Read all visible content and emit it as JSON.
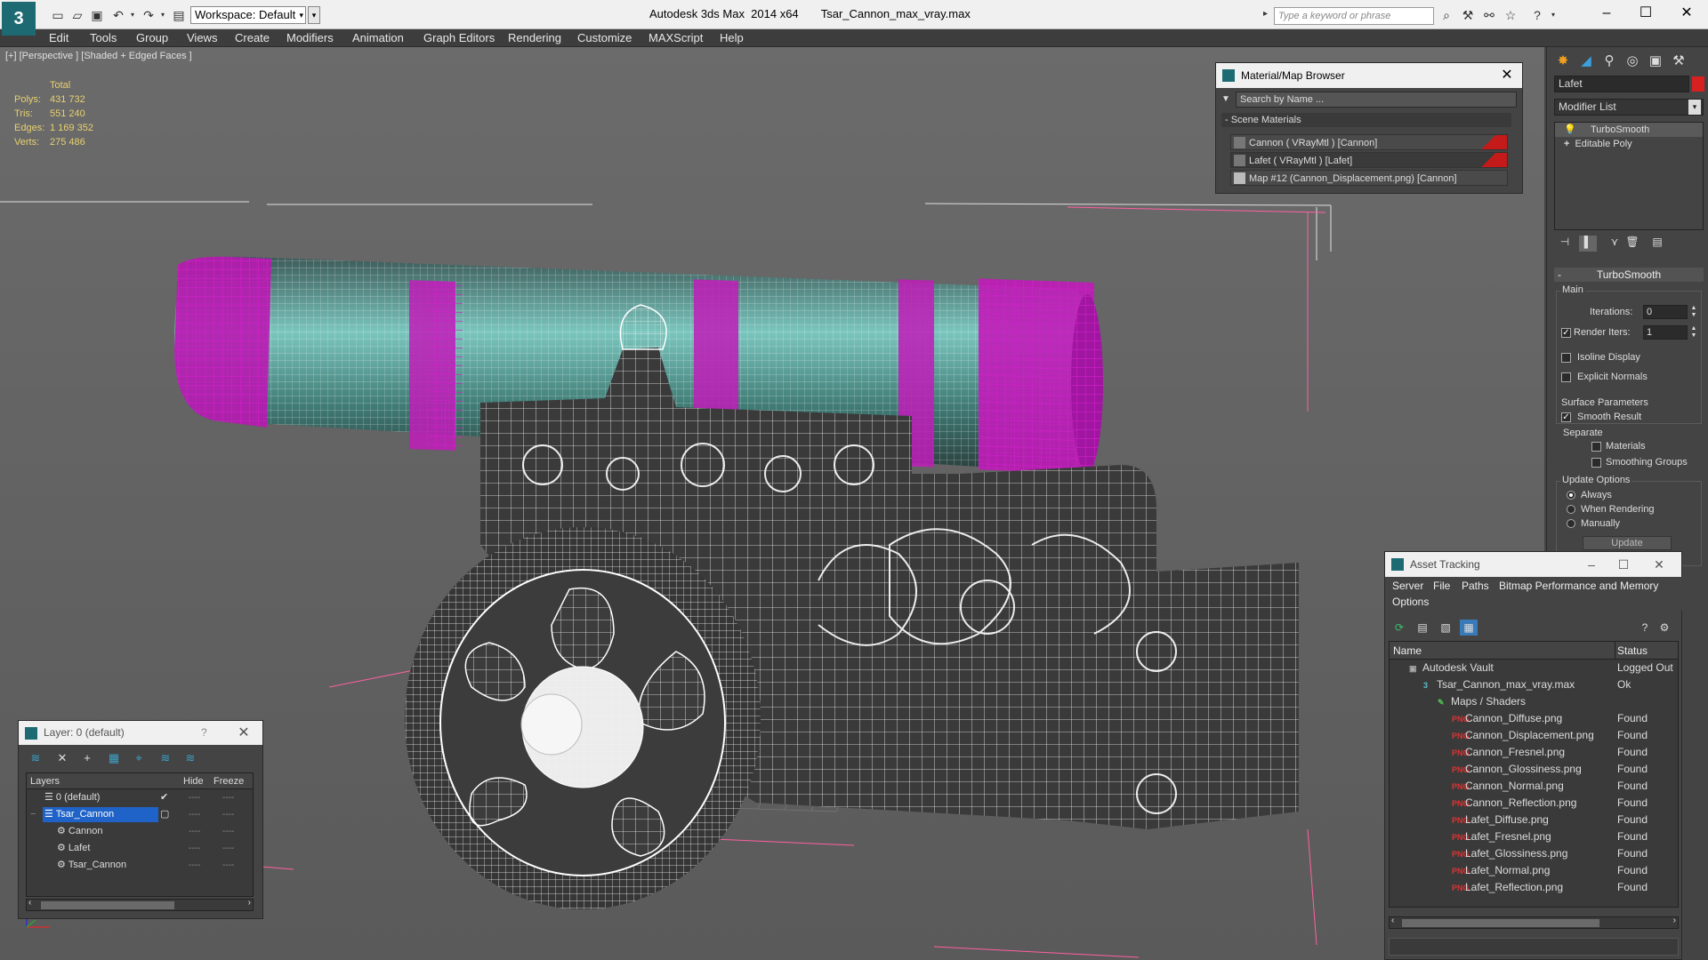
{
  "titlebar": {
    "workspace": "Workspace: Default",
    "app_title": "Autodesk 3ds Max  2014 x64",
    "file_title": "Tsar_Cannon_max_vray.max",
    "search_placeholder": "Type a keyword or phrase"
  },
  "menu": [
    "Edit",
    "Tools",
    "Group",
    "Views",
    "Create",
    "Modifiers",
    "Animation",
    "Graph Editors",
    "Rendering",
    "Customize",
    "MAXScript",
    "Help"
  ],
  "viewport": {
    "label": "[+] [Perspective ] [Shaded + Edged Faces ]",
    "stats": {
      "header": "Total",
      "polys_label": "Polys:",
      "polys": "431 732",
      "tris_label": "Tris:",
      "tris": "551 240",
      "edges_label": "Edges:",
      "edges": "1 169 352",
      "verts_label": "Verts:",
      "verts": "275 486"
    }
  },
  "material_browser": {
    "title": "Material/Map Browser",
    "search_placeholder": "Search by Name ...",
    "group": "- Scene Materials",
    "items": [
      "Cannon  ( VRayMtl ) [Cannon]",
      "Lafet  ( VRayMtl ) [Lafet]",
      "Map #12 (Cannon_Displacement.png) [Cannon]"
    ]
  },
  "command_panel": {
    "object_name": "Lafet",
    "object_color": "#d72020",
    "modifier_list": "Modifier List",
    "stack": [
      "TurboSmooth",
      "Editable Poly"
    ],
    "rollout_title": "TurboSmooth",
    "main_group": "Main",
    "iterations_label": "Iterations:",
    "iterations_value": "0",
    "render_iters_label": "Render Iters:",
    "render_iters_value": "1",
    "isoline_label": "Isoline Display",
    "explicit_label": "Explicit Normals",
    "surface_group": "Surface Parameters",
    "smooth_result_label": "Smooth Result",
    "separate_label": "Separate",
    "materials_label": "Materials",
    "smoothing_groups_label": "Smoothing Groups",
    "update_group": "Update Options",
    "always_label": "Always",
    "when_rendering_label": "When Rendering",
    "manually_label": "Manually",
    "update_button": "Update"
  },
  "layers": {
    "title": "Layer: 0 (default)",
    "help": "?",
    "col_layers": "Layers",
    "col_hide": "Hide",
    "col_freeze": "Freeze",
    "rows": [
      {
        "name": "0 (default)"
      },
      {
        "name": "Tsar_Cannon"
      },
      {
        "name": "Cannon"
      },
      {
        "name": "Lafet"
      },
      {
        "name": "Tsar_Cannon"
      }
    ],
    "dash": "----"
  },
  "asset_tracking": {
    "title": "Asset Tracking",
    "menu": [
      "Server",
      "File",
      "Paths",
      "Bitmap Performance and Memory",
      "Options"
    ],
    "col_name": "Name",
    "col_status": "Status",
    "rows": [
      {
        "name": "Autodesk Vault",
        "status": "Logged Out"
      },
      {
        "name": "Tsar_Cannon_max_vray.max",
        "status": "Ok"
      },
      {
        "name": "Maps / Shaders",
        "status": ""
      },
      {
        "name": "Cannon_Diffuse.png",
        "status": "Found"
      },
      {
        "name": "Cannon_Displacement.png",
        "status": "Found"
      },
      {
        "name": "Cannon_Fresnel.png",
        "status": "Found"
      },
      {
        "name": "Cannon_Glossiness.png",
        "status": "Found"
      },
      {
        "name": "Cannon_Normal.png",
        "status": "Found"
      },
      {
        "name": "Cannon_Reflection.png",
        "status": "Found"
      },
      {
        "name": "Lafet_Diffuse.png",
        "status": "Found"
      },
      {
        "name": "Lafet_Fresnel.png",
        "status": "Found"
      },
      {
        "name": "Lafet_Glossiness.png",
        "status": "Found"
      },
      {
        "name": "Lafet_Normal.png",
        "status": "Found"
      },
      {
        "name": "Lafet_Reflection.png",
        "status": "Found"
      }
    ]
  },
  "colors": {
    "wire_magenta": "#d020c8",
    "wire_white": "#f0f0f0",
    "barrel_teal": "#5aa8a0",
    "selection_blue": "#1f63c8",
    "stats_yellow": "#e8d070"
  }
}
